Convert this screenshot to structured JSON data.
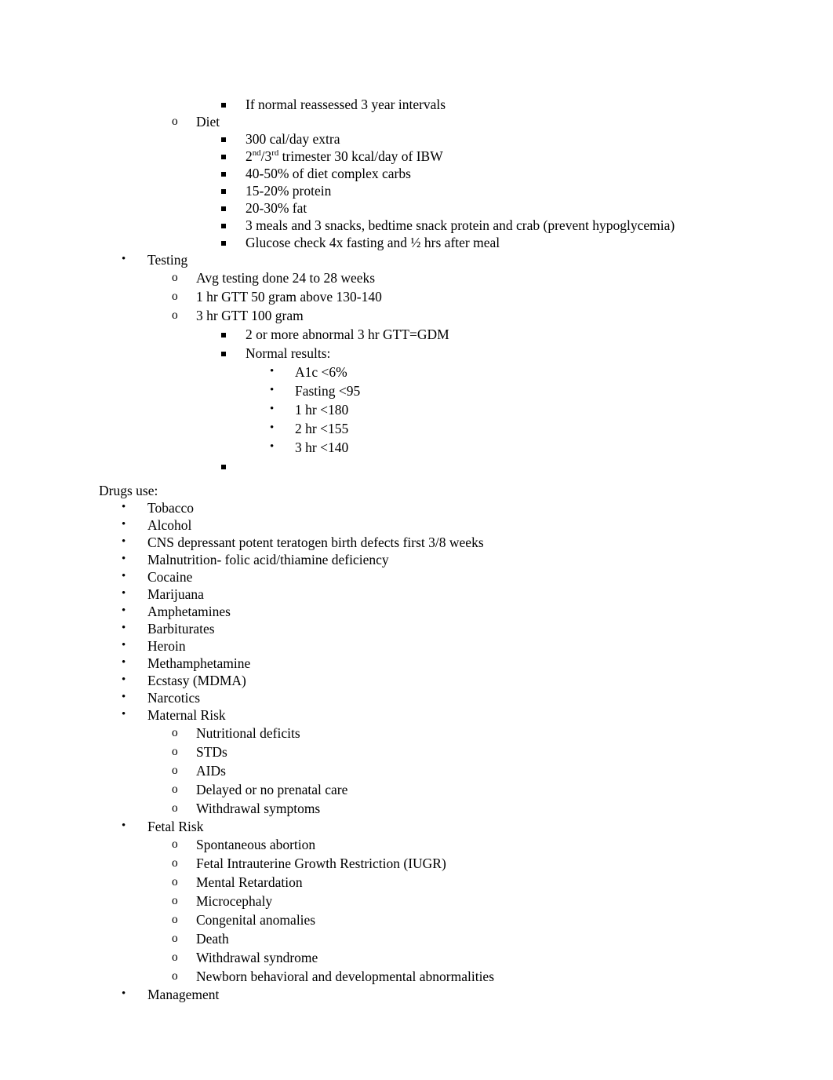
{
  "document": {
    "background_color": "#ffffff",
    "text_color": "#000000",
    "bullet_glyphs": {
      "level1": "•",
      "level2": "o",
      "level3": "square",
      "level4": "•"
    }
  },
  "outline": {
    "screening_tail": {
      "if_normal": "If normal reassessed 3 year intervals"
    },
    "diet": {
      "heading": "Diet",
      "items": [
        "300 cal/day extra",
        "2nd/3rd trimester 30 kcal/day of IBW",
        "40-50% of diet complex carbs",
        "15-20% protein",
        "20-30% fat",
        "3 meals and 3 snacks, bedtime snack protein and crab (prevent hypoglycemia)",
        "Glucose check 4x fasting and ½ hrs after meal"
      ],
      "trimester_item": {
        "num1": "2",
        "sup1": "nd",
        "sep": "/",
        "num2": "3",
        "sup2": "rd",
        "rest": " trimester 30 kcal/day of IBW"
      }
    },
    "testing": {
      "heading": "Testing",
      "items": [
        "Avg testing done 24 to 28 weeks",
        "1 hr GTT 50 gram above 130-140",
        "3 hr GTT 100 gram"
      ],
      "gtt_sub_items": [
        "2 or more abnormal 3 hr GTT=GDM",
        "Normal results:"
      ],
      "normal_results": [
        "A1c <6%",
        "Fasting <95",
        "1 hr <180",
        "2 hr <155",
        "3 hr <140"
      ],
      "empty_bullet": ""
    },
    "drugs_use": {
      "heading": "Drugs use:",
      "items": [
        "Tobacco",
        "Alcohol",
        "CNS depressant potent teratogen birth defects first 3/8 weeks",
        "Malnutrition- folic acid/thiamine deficiency",
        "Cocaine",
        "Marijuana",
        "Amphetamines",
        "Barbiturates",
        "Heroin",
        "Methamphetamine",
        "Ecstasy (MDMA)",
        "Narcotics"
      ],
      "maternal_risk": {
        "heading": "Maternal Risk",
        "items": [
          "Nutritional deficits",
          "STDs",
          "AIDs",
          "Delayed or no prenatal care",
          "Withdrawal symptoms"
        ]
      },
      "fetal_risk": {
        "heading": "Fetal Risk",
        "items": [
          "Spontaneous abortion",
          "Fetal Intrauterine Growth Restriction (IUGR)",
          "Mental Retardation",
          "Microcephaly",
          "Congenital anomalies",
          "Death",
          "Withdrawal syndrome",
          "Newborn behavioral and developmental abnormalities"
        ]
      },
      "management": "Management"
    }
  }
}
